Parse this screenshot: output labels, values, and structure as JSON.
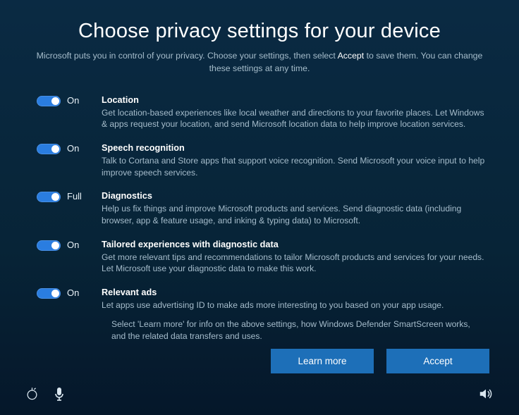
{
  "header": {
    "title": "Choose privacy settings for your device",
    "subtitle_before": "Microsoft puts you in control of your privacy.  Choose your settings, then select ",
    "subtitle_accept": "Accept",
    "subtitle_after": " to save them. You can change these settings at any time."
  },
  "settings": [
    {
      "state": "On",
      "title": "Location",
      "desc": "Get location-based experiences like local weather and directions to your favorite places.  Let Windows & apps request your location, and send Microsoft location data to help improve location services."
    },
    {
      "state": "On",
      "title": "Speech recognition",
      "desc": "Talk to Cortana and Store apps that support voice recognition.  Send Microsoft your voice input to help improve speech services."
    },
    {
      "state": "Full",
      "title": "Diagnostics",
      "desc": "Help us fix things and improve Microsoft products and services.  Send diagnostic data (including browser, app & feature usage, and inking & typing data) to Microsoft."
    },
    {
      "state": "On",
      "title": "Tailored experiences with diagnostic data",
      "desc": "Get more relevant tips and recommendations to tailor Microsoft products and services for your needs.  Let Microsoft use your diagnostic data to make this work."
    },
    {
      "state": "On",
      "title": "Relevant ads",
      "desc": "Let apps use advertising ID to make ads more interesting to you based on your app usage."
    }
  ],
  "footnote": "Select 'Learn more' for info on the above settings, how Windows Defender SmartScreen works, and the related data transfers and uses.",
  "buttons": {
    "learn_more": "Learn more",
    "accept": "Accept"
  }
}
